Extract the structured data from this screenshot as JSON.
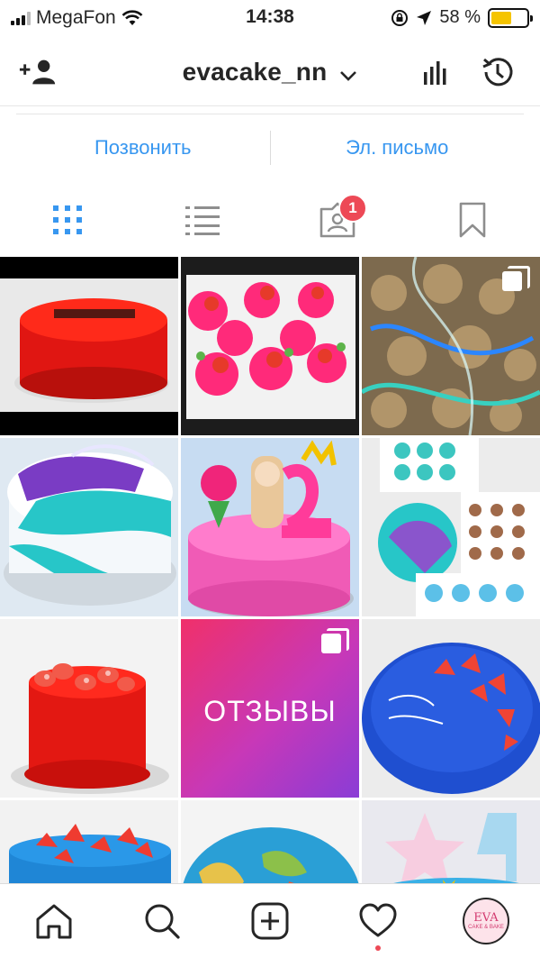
{
  "status_bar": {
    "carrier": "MegaFon",
    "time": "14:38",
    "battery": "58 %",
    "battery_level": 0.58,
    "icons": [
      "signal-icon",
      "wifi-icon",
      "orientation-lock-icon",
      "location-icon",
      "battery-icon"
    ]
  },
  "header": {
    "username": "evacake_nn",
    "icons": [
      "add-person-icon",
      "chevron-down-icon",
      "insights-icon",
      "history-icon"
    ]
  },
  "contact": {
    "call_label": "Позвонить",
    "email_label": "Эл. письмо"
  },
  "tabs": {
    "items": [
      "grid-icon",
      "list-icon",
      "tagged-icon",
      "bookmark-icon"
    ],
    "tagged_badge": "1"
  },
  "grid": {
    "reviews_label": "ОТЗЫВЫ",
    "posts": [
      {
        "name": "red-velvet-cake",
        "multi": false
      },
      {
        "name": "strawberry-cupcakes",
        "multi": false
      },
      {
        "name": "wrapped-cake-pops",
        "multi": true
      },
      {
        "name": "turquoise-mirror-cake",
        "multi": false
      },
      {
        "name": "pink-birthday-cake",
        "multi": false
      },
      {
        "name": "cupcake-boxes",
        "multi": false
      },
      {
        "name": "red-strawberry-cake",
        "multi": false
      },
      {
        "name": "reviews-tile",
        "multi": true
      },
      {
        "name": "blue-strawberry-cake",
        "multi": false
      },
      {
        "name": "blue-cake-strawberries",
        "multi": false
      },
      {
        "name": "world-map-cake",
        "multi": false
      },
      {
        "name": "number-four-cookie-cake",
        "multi": false
      }
    ]
  },
  "colors": {
    "accent_blue": "#3897f0",
    "badge_red": "#ed4956",
    "text": "#262626",
    "divider": "#dbdbdb"
  },
  "bottom_bar": {
    "items": [
      "home-icon",
      "search-icon",
      "new-post-icon",
      "activity-heart-icon",
      "profile-avatar"
    ],
    "avatar_text": "EVA",
    "avatar_subtext": "CAKE & BAKE"
  }
}
